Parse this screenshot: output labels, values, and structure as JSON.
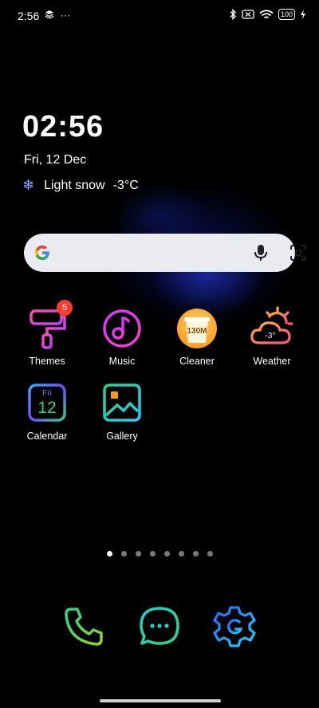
{
  "status_bar": {
    "time": "2:56",
    "overflow": "···",
    "battery": "100"
  },
  "clock_widget": {
    "time": "02:56",
    "date": "Fri, 12 Dec",
    "weather": "Light snow",
    "temperature": "-3°C"
  },
  "apps": [
    {
      "label": "Themes",
      "badge": "5"
    },
    {
      "label": "Music"
    },
    {
      "label": "Cleaner",
      "icon_text": "130M"
    },
    {
      "label": "Weather",
      "icon_text": "-3°"
    },
    {
      "label": "Calendar",
      "icon_day": "Fri",
      "icon_date": "12"
    },
    {
      "label": "Gallery"
    }
  ],
  "page_indicator": {
    "count": 8,
    "active": 1
  },
  "dock": [
    "phone-icon",
    "messages-icon",
    "settings-icon"
  ]
}
